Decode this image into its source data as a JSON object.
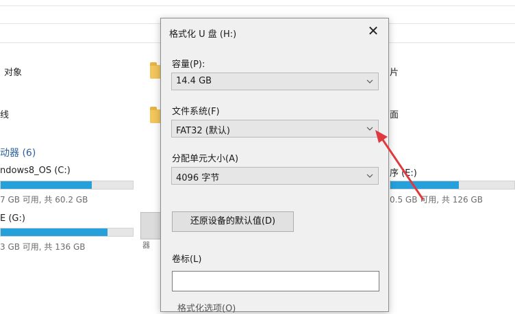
{
  "background": {
    "left_items": [
      "对象",
      "线"
    ],
    "section_header": "动器 (6)",
    "drives_left": [
      {
        "name": "ndows8_OS (C:)",
        "info": "7 GB 可用, 共 60.2 GB",
        "used_fraction": 0.69
      },
      {
        "name": "E (G:)",
        "info": "3 GB 可用, 共 136 GB",
        "used_fraction": 0.81
      }
    ],
    "right_items": [
      "片",
      "面"
    ],
    "drive_right": {
      "name": "序 (E:)",
      "info": "0.5 GB 可用, 共 126 GB",
      "used_fraction": 0.63
    },
    "thumb_caption": "器"
  },
  "dialog": {
    "title": "格式化 U 盘 (H:)",
    "close_glyph": "✕",
    "capacity_label": "容量(P):",
    "capacity_value": "14.4 GB",
    "filesystem_label": "文件系统(F)",
    "filesystem_value": "FAT32 (默认)",
    "unit_label": "分配单元大小(A)",
    "unit_value": "4096 字节",
    "restore_button": "还原设备的默认值(D)",
    "volume_label": "卷标(L)",
    "volume_value": "",
    "format_options_label": "格式化选项(O)"
  },
  "colors": {
    "accent": "#26a0da",
    "arrow": "#e0393d"
  }
}
